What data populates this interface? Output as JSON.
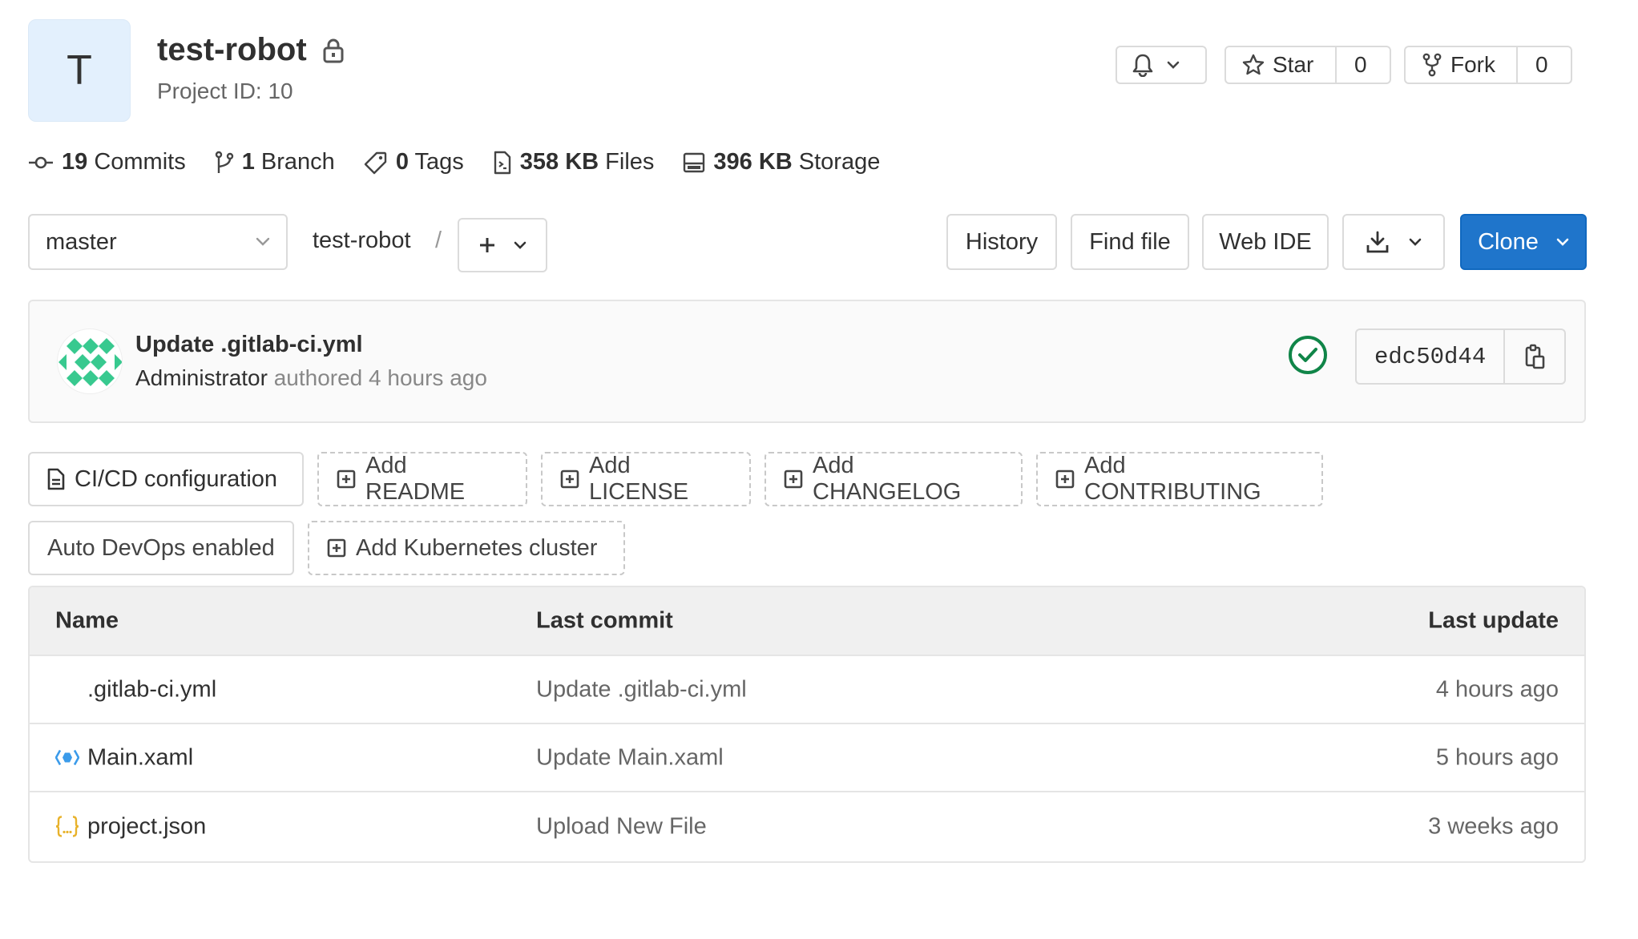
{
  "project": {
    "avatar_letter": "T",
    "name": "test-robot",
    "id_label": "Project ID: 10"
  },
  "header_actions": {
    "star_label": "Star",
    "star_count": "0",
    "fork_label": "Fork",
    "fork_count": "0"
  },
  "stats": [
    {
      "value": "19",
      "label": "Commits",
      "icon": "commit-icon"
    },
    {
      "value": "1",
      "label": "Branch",
      "icon": "branch-icon"
    },
    {
      "value": "0",
      "label": "Tags",
      "icon": "tag-icon"
    },
    {
      "value": "358 KB",
      "label": "Files",
      "icon": "file-icon"
    },
    {
      "value": "396 KB",
      "label": "Storage",
      "icon": "storage-icon"
    }
  ],
  "toolbar": {
    "branch": "master",
    "breadcrumb": "test-robot",
    "separator": "/",
    "history": "History",
    "find_file": "Find file",
    "web_ide": "Web IDE",
    "clone": "Clone"
  },
  "last_commit": {
    "title": "Update .gitlab-ci.yml",
    "author": "Administrator",
    "meta": "authored 4 hours ago",
    "sha": "edc50d44",
    "status": "passed",
    "status_color": "#108548"
  },
  "quick_actions": [
    {
      "label": "CI/CD configuration",
      "style": "solid",
      "icon": "file-icon"
    },
    {
      "label": "Add README",
      "style": "dashed",
      "icon": "plus-square-icon"
    },
    {
      "label": "Add LICENSE",
      "style": "dashed",
      "icon": "plus-square-icon"
    },
    {
      "label": "Add CHANGELOG",
      "style": "dashed",
      "icon": "plus-square-icon"
    },
    {
      "label": "Add CONTRIBUTING",
      "style": "dashed",
      "icon": "plus-square-icon"
    },
    {
      "label": "Auto DevOps enabled",
      "style": "solid",
      "icon": ""
    },
    {
      "label": "Add Kubernetes cluster",
      "style": "dashed",
      "icon": "plus-square-icon"
    }
  ],
  "files": {
    "headers": {
      "name": "Name",
      "last_commit": "Last commit",
      "last_update": "Last update"
    },
    "rows": [
      {
        "name": ".gitlab-ci.yml",
        "commit": "Update .gitlab-ci.yml",
        "updated": "4 hours ago",
        "icon": "yaml-icon"
      },
      {
        "name": "Main.xaml",
        "commit": "Update Main.xaml",
        "updated": "5 hours ago",
        "icon": "xaml-icon"
      },
      {
        "name": "project.json",
        "commit": "Upload New File",
        "updated": "3 weeks ago",
        "icon": "json-icon"
      }
    ]
  },
  "colors": {
    "primary": "#1f75cb",
    "success": "#108548",
    "json_icon": "#e8b22b",
    "xaml_icon": "#3b9bea",
    "identicon": "#38c98f"
  }
}
